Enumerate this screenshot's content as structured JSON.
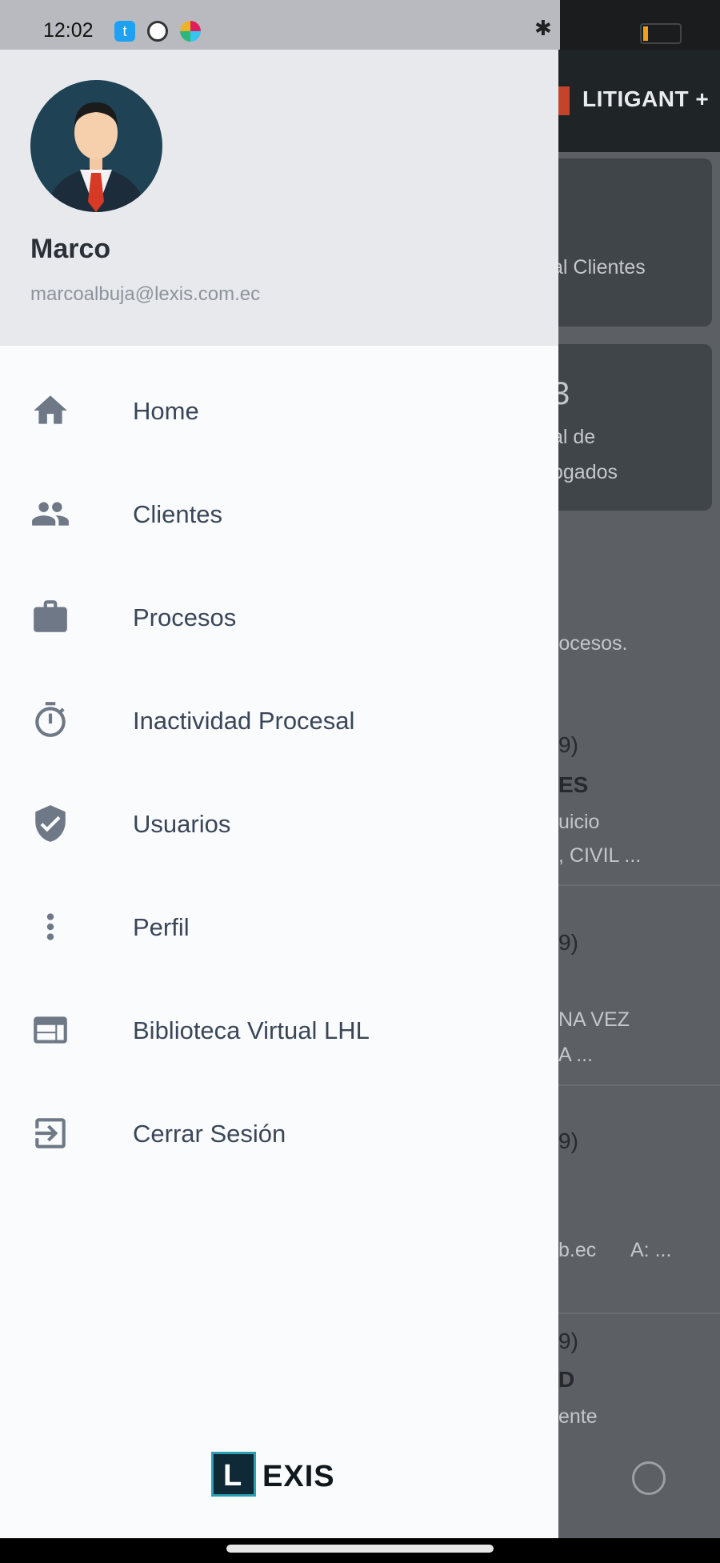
{
  "status_bar": {
    "time": "12:02"
  },
  "background_app": {
    "title": "LITIGANT +",
    "card1_label": "al Clientes",
    "card2_number": "3",
    "card2_line1": "al de",
    "card2_line2": "ogados",
    "snippet": "rocesos.",
    "row1": {
      "a": "9)",
      "b": "ES",
      "c": "uicio",
      "d": ", CIVIL ..."
    },
    "row2": {
      "a": "9)",
      "b": "NA VEZ",
      "c": "A ..."
    },
    "row3": {
      "a": "9)",
      "b": "b.ec",
      "c": "A: ..."
    },
    "row4": {
      "a": "9)",
      "b": "D",
      "c": "ente"
    }
  },
  "drawer": {
    "user_name": "Marco",
    "user_email": "marcoalbuja@lexis.com.ec",
    "menu": [
      {
        "label": "Home",
        "icon": "home-icon"
      },
      {
        "label": "Clientes",
        "icon": "people-icon"
      },
      {
        "label": "Procesos",
        "icon": "briefcase-icon"
      },
      {
        "label": "Inactividad Procesal",
        "icon": "timer-icon"
      },
      {
        "label": "Usuarios",
        "icon": "shield-check-icon"
      },
      {
        "label": "Perfil",
        "icon": "more-vertical-icon"
      },
      {
        "label": "Biblioteca Virtual LHL",
        "icon": "web-icon"
      },
      {
        "label": "Cerrar Sesión",
        "icon": "logout-icon"
      }
    ],
    "footer_logo_letter": "L",
    "footer_logo_text": "EXIS"
  },
  "colors": {
    "icon": "#6e7886",
    "label": "#3a4658",
    "header_bg": "#e8e9ed"
  }
}
